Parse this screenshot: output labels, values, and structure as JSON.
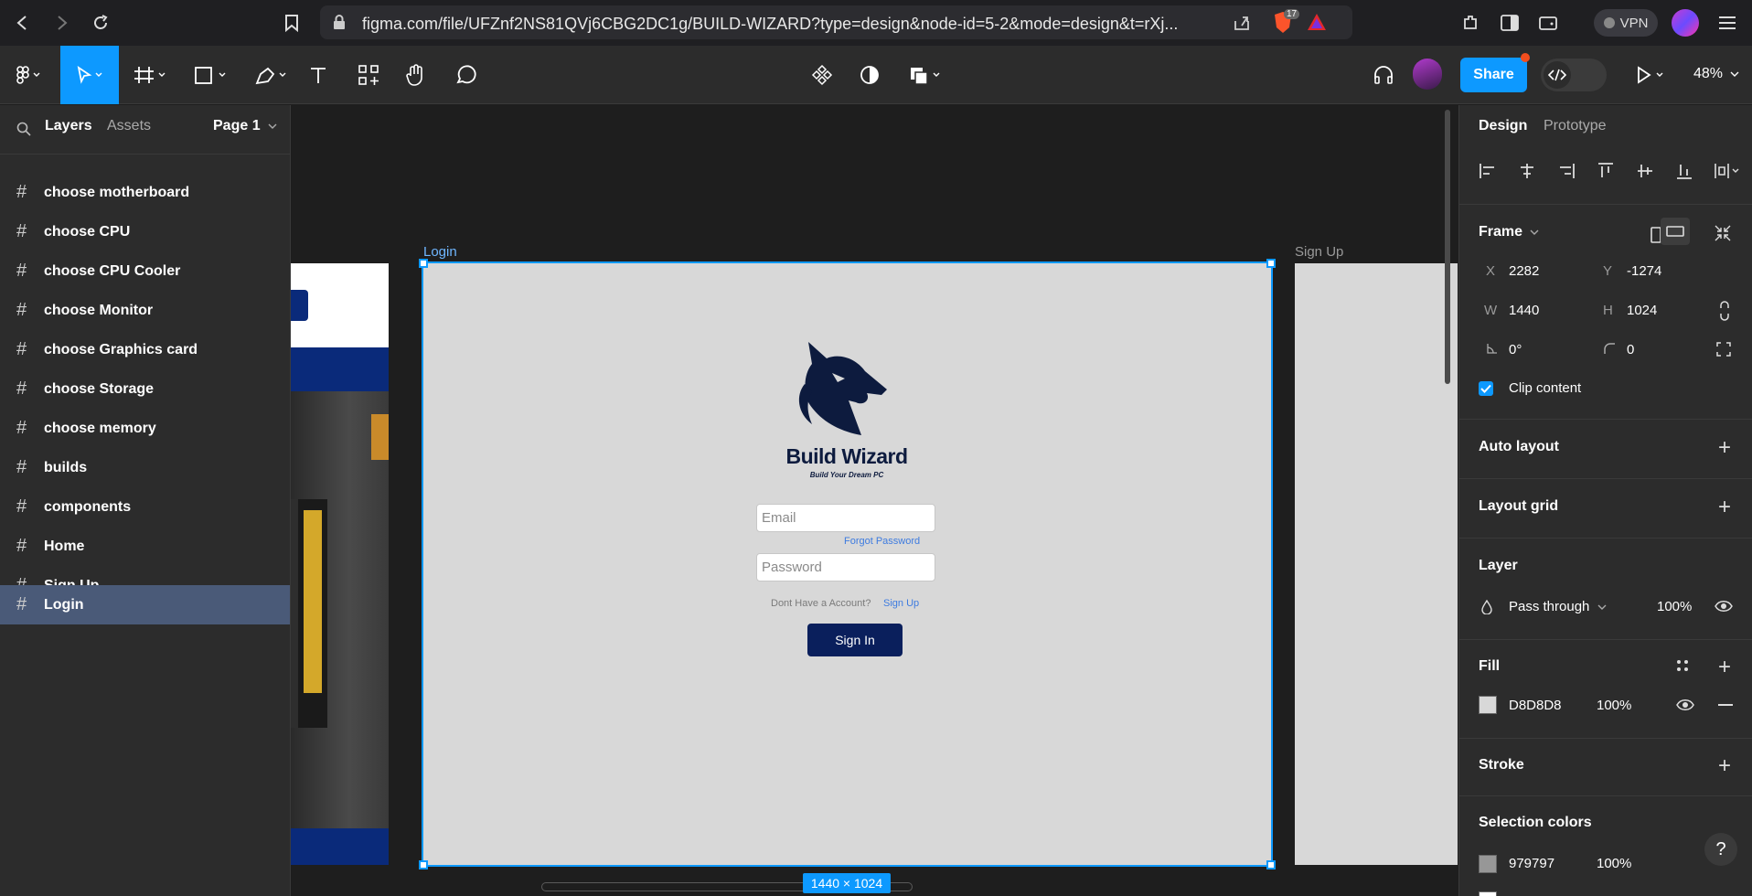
{
  "browser": {
    "url": "figma.com/file/UFZnf2NS81QVj6CBG2DC1g/BUILD-WIZARD?type=design&node-id=5-2&mode=design&t=rXj...",
    "brave_badge": "17",
    "vpn_label": "VPN"
  },
  "toolbar": {
    "share_label": "Share",
    "zoom": "48%"
  },
  "left_panel": {
    "tabs": [
      "Layers",
      "Assets"
    ],
    "page_selector": "Page 1",
    "layers": [
      {
        "label": "choose motherboard",
        "selected": false
      },
      {
        "label": "choose CPU",
        "selected": false
      },
      {
        "label": "choose CPU Cooler",
        "selected": false
      },
      {
        "label": "choose Monitor",
        "selected": false
      },
      {
        "label": "choose Graphics card",
        "selected": false
      },
      {
        "label": "choose Storage",
        "selected": false
      },
      {
        "label": "choose memory",
        "selected": false
      },
      {
        "label": "builds",
        "selected": false
      },
      {
        "label": "components",
        "selected": false
      },
      {
        "label": "Home",
        "selected": false
      },
      {
        "label": "Sign Up",
        "selected": false
      },
      {
        "label": "Login",
        "selected": true
      }
    ]
  },
  "canvas": {
    "login_frame_label": "Login",
    "signup_frame_label": "Sign Up",
    "dims_badge": "1440 × 1024",
    "login": {
      "brand": "Build Wizard",
      "tagline": "Build Your Dream PC",
      "email_placeholder": "Email",
      "forgot_password": "Forgot Password",
      "password_placeholder": "Password",
      "no_account": "Dont Have a Account?",
      "signup_link": "Sign Up",
      "signin_button": "Sign In"
    }
  },
  "right_panel": {
    "tabs": [
      "Design",
      "Prototype"
    ],
    "frame_title": "Frame",
    "x_label": "X",
    "x_value": "2282",
    "y_label": "Y",
    "y_value": "-1274",
    "w_label": "W",
    "w_value": "1440",
    "h_label": "H",
    "h_value": "1024",
    "rotation": "0°",
    "radius": "0",
    "clip_content": "Clip content",
    "auto_layout": "Auto layout",
    "layout_grid": "Layout grid",
    "layer_title": "Layer",
    "blend_mode": "Pass through",
    "layer_opacity": "100%",
    "fill_title": "Fill",
    "fill_hex": "D8D8D8",
    "fill_opacity": "100%",
    "stroke_title": "Stroke",
    "selection_colors_title": "Selection colors",
    "sel_color_hex": "979797",
    "sel_color_opacity": "100%",
    "help": "?"
  },
  "colors": {
    "accent": "#0d99ff",
    "brand_navy": "#0a1f5c",
    "frame_fill": "#d8d8d8",
    "sel_color": "#979797"
  }
}
